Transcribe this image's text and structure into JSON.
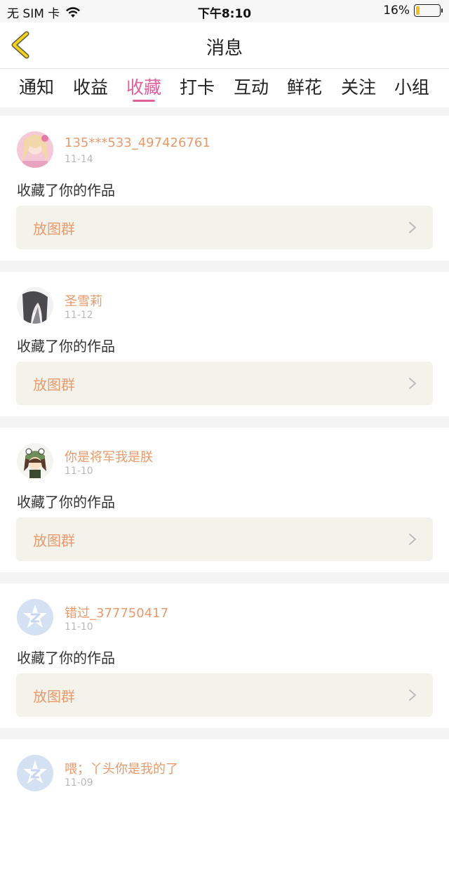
{
  "status": {
    "carrier": "无 SIM 卡",
    "time": "下午8:10",
    "battery_percent": "16%",
    "battery_level": 0.16,
    "battery_color": "#f0c020"
  },
  "nav": {
    "title": "消息"
  },
  "tabs": [
    {
      "label": "通知"
    },
    {
      "label": "收益"
    },
    {
      "label": "收藏"
    },
    {
      "label": "打卡"
    },
    {
      "label": "互动"
    },
    {
      "label": "鲜花"
    },
    {
      "label": "关注"
    },
    {
      "label": "小组"
    }
  ],
  "active_tab_index": 2,
  "colors": {
    "accent": "#e0609c",
    "username": "#e89a6a"
  },
  "messages": [
    {
      "username": "135***533_497426761",
      "date": "11-14",
      "action": "收藏了你的作品",
      "work": "放图群",
      "avatar": "pink-anime-avatar"
    },
    {
      "username": "圣雪莉",
      "date": "11-12",
      "action": "收藏了你的作品",
      "work": "放图群",
      "avatar": "dark-hair-anime-avatar"
    },
    {
      "username": "你是将军我是朕",
      "date": "11-10",
      "action": "收藏了你的作品",
      "work": "放图群",
      "avatar": "frog-hat-girl-avatar"
    },
    {
      "username": "错过_377750417",
      "date": "11-10",
      "action": "收藏了你的作品",
      "work": "放图群",
      "avatar": "default-z-avatar"
    },
    {
      "username": "喂；丫头你是我的了",
      "date": "11-09",
      "action": "",
      "work": "",
      "avatar": "default-z-avatar"
    }
  ]
}
